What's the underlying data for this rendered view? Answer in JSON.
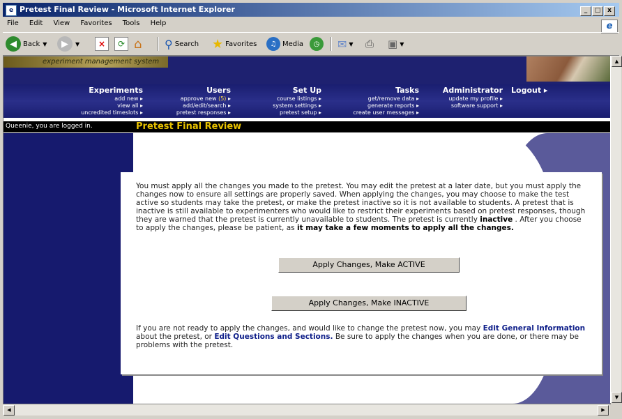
{
  "window": {
    "title": "Pretest Final Review - Microsoft Internet Explorer",
    "controls": [
      "_",
      "□",
      "x"
    ]
  },
  "menu": [
    "File",
    "Edit",
    "View",
    "Favorites",
    "Tools",
    "Help"
  ],
  "toolbar": {
    "back": "Back",
    "search": "Search",
    "favorites": "Favorites",
    "media": "Media"
  },
  "banner": {
    "logo_text": "experiment management system"
  },
  "nav": {
    "experiments": {
      "heading": "Experiments",
      "items": [
        "add new",
        "view all",
        "uncredited timeslots"
      ]
    },
    "users": {
      "heading": "Users",
      "approve_prefix": "approve new ",
      "approve_count": "(5)",
      "items": [
        "add/edit/search",
        "pretest responses"
      ]
    },
    "setup": {
      "heading": "Set Up",
      "items": [
        "course listings",
        "system settings",
        "pretest setup"
      ]
    },
    "tasks": {
      "heading": "Tasks",
      "items": [
        "get/remove data",
        "generate reports",
        "create user messages"
      ]
    },
    "admin": {
      "heading": "Administrator",
      "items": [
        "update my profile",
        "software support"
      ]
    },
    "logout": "Logout"
  },
  "status": {
    "logged_in": "Queenie, you are logged in.",
    "page_title": "Pretest Final Review"
  },
  "content": {
    "p1_a": "You must apply all the changes you made to the pretest. You may edit the pretest at a later date, but you must apply the changes now to ensure all settings are properly saved. When applying the changes, you may choose to make the test active so students may take the pretest, or make the pretest inactive so it is not available to students. A pretest that is inactive is still available to experimenters who would like to restrict their experiments based on pretest responses, though they are warned that the pretest is currently unavailable to students. The pretest is currently ",
    "p1_status": "inactive",
    "p1_b": " . After you choose to apply the changes, please be patient, as ",
    "p1_bold": "it may take a few moments to apply all the changes.",
    "btn_active": "Apply Changes, Make ACTIVE",
    "btn_inactive": "Apply Changes, Make INACTIVE",
    "p2_a": "If you are not ready to apply the changes, and would like to change the pretest now, you may ",
    "link_general": "Edit General Information",
    "p2_b": " about the pretest, or ",
    "link_questions": "Edit Questions and Sections.",
    "p2_c": " Be sure to apply the changes when you are done, or there may be problems with the pretest."
  }
}
